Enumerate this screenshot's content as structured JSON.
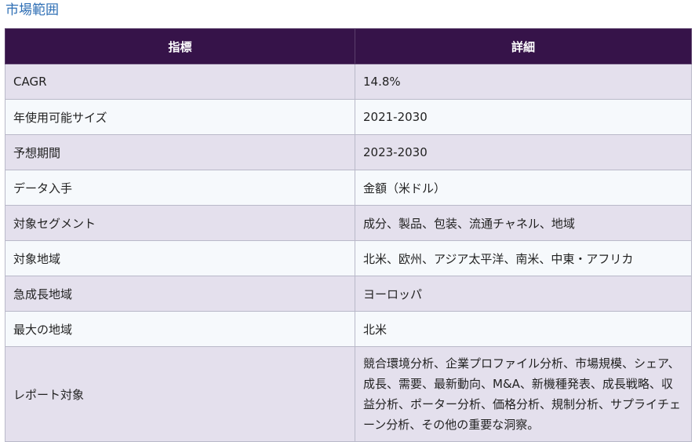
{
  "heading": "市場範囲",
  "table": {
    "headers": [
      "指標",
      "詳細"
    ],
    "rows": [
      {
        "metric": "CAGR",
        "detail": "14.8%"
      },
      {
        "metric": "年使用可能サイズ",
        "detail": "2021-2030"
      },
      {
        "metric": "予想期間",
        "detail": "2023-2030"
      },
      {
        "metric": "データ入手",
        "detail": "金額（米ドル）"
      },
      {
        "metric": "対象セグメント",
        "detail": "成分、製品、包装、流通チャネル、地域"
      },
      {
        "metric": "対象地域",
        "detail": "北米、欧州、アジア太平洋、南米、中東・アフリカ"
      },
      {
        "metric": "急成長地域",
        "detail": "ヨーロッパ"
      },
      {
        "metric": "最大の地域",
        "detail": "北米"
      },
      {
        "metric": "レポート対象",
        "detail": "競合環境分析、企業プロファイル分析、市場規模、シェア、成長、需要、最新動向、M&A、新機種発表、成長戦略、収益分析、ポーター分析、価格分析、規制分析、サプライチェーン分析、その他の重要な洞察。"
      }
    ]
  }
}
